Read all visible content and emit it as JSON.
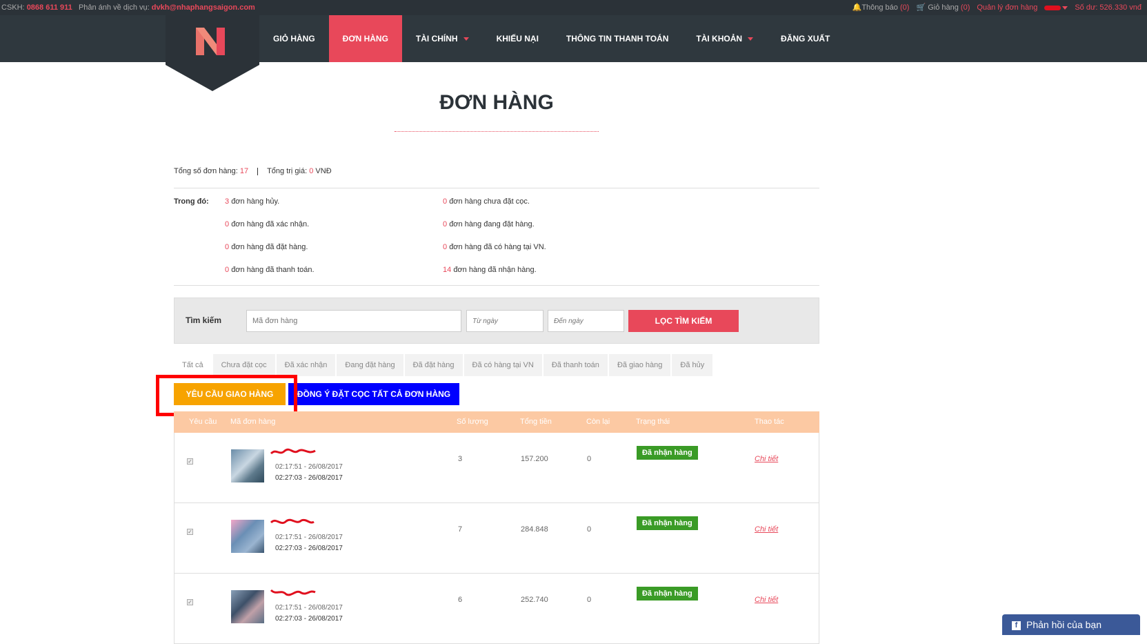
{
  "topbar": {
    "cskh_label": "CSKH:",
    "cskh_phone": "0868 611 911",
    "service_label": "Phản ánh về dịch vụ:",
    "service_email": "dvkh@nhaphangsaigon.com",
    "notify_label": "Thông báo",
    "notify_count": "(0)",
    "cart_label": "Giỏ hàng",
    "cart_count": "(0)",
    "manage_label": "Quản lý đơn hàng",
    "balance": "Số dư: 526.330 vnđ"
  },
  "nav": {
    "items": [
      "GIỎ HÀNG",
      "ĐƠN HÀNG",
      "TÀI CHÍNH",
      "KHIẾU NẠI",
      "THÔNG TIN THANH TOÁN",
      "TÀI KHOẢN",
      "ĐĂNG XUẤT"
    ]
  },
  "page": {
    "title": "ĐƠN HÀNG"
  },
  "summary": {
    "total_label": "Tổng số đơn hàng:",
    "total_value": "17",
    "value_label": "Tổng trị giá:",
    "value_amount": "0",
    "value_unit": "VNĐ"
  },
  "breakdown": {
    "label": "Trong đó:",
    "items": [
      {
        "count": "3",
        "text": "đơn hàng hủy."
      },
      {
        "count": "0",
        "text": "đơn hàng chưa đặt cọc."
      },
      {
        "count": "0",
        "text": "đơn hàng đã xác nhận."
      },
      {
        "count": "0",
        "text": "đơn hàng đang đặt hàng."
      },
      {
        "count": "0",
        "text": "đơn hàng đã đặt hàng."
      },
      {
        "count": "0",
        "text": "đơn hàng đã có hàng tại VN."
      },
      {
        "count": "0",
        "text": "đơn hàng đã thanh toán."
      },
      {
        "count": "14",
        "text": "đơn hàng đã nhận hàng."
      }
    ]
  },
  "search": {
    "label": "Tìm kiếm",
    "code_placeholder": "Mã đơn hàng",
    "from_placeholder": "Từ ngày",
    "to_placeholder": "Đến ngày",
    "button": "LỌC TÌM KIẾM"
  },
  "tabs": [
    "Tất cả",
    "Chưa đặt cọc",
    "Đã xác nhận",
    "Đang đặt hàng",
    "Đã đặt hàng",
    "Đã có hàng tại VN",
    "Đã thanh toán",
    "Đã giao hàng",
    "Đã hủy"
  ],
  "actions": {
    "request_delivery": "YÊU CẦU GIAO HÀNG",
    "accept_deposit": "ĐỒNG Ý ĐẶT CỌC TẤT CẢ ĐƠN HÀNG"
  },
  "table": {
    "headers": [
      "Yêu cầu",
      "Mã đơn hàng",
      "Số lượng",
      "Tổng tiền",
      "Còn lại",
      "Trạng thái",
      "Thao tác"
    ],
    "rows": [
      {
        "time1": "02:17:51 - 26/08/2017",
        "time2": "02:27:03 - 26/08/2017",
        "qty": "3",
        "total": "157.200",
        "remaining": "0",
        "status": "Đã nhận hàng",
        "action": "Chi tiết"
      },
      {
        "time1": "02:17:51 - 26/08/2017",
        "time2": "02:27:03 - 26/08/2017",
        "qty": "7",
        "total": "284.848",
        "remaining": "0",
        "status": "Đã nhận hàng",
        "action": "Chi tiết"
      },
      {
        "time1": "02:17:51 - 26/08/2017",
        "time2": "02:27:03 - 26/08/2017",
        "qty": "6",
        "total": "252.740",
        "remaining": "0",
        "status": "Đã nhận hàng",
        "action": "Chi tiết"
      }
    ]
  },
  "feedback": {
    "label": "Phản hồi của bạn"
  },
  "colors": {
    "accent": "#e8485a",
    "nav_bg": "#2f383e",
    "orange": "#f7a300",
    "blue": "#0000ff",
    "status_green": "#3a9b26",
    "table_header": "#fcc9a3"
  }
}
